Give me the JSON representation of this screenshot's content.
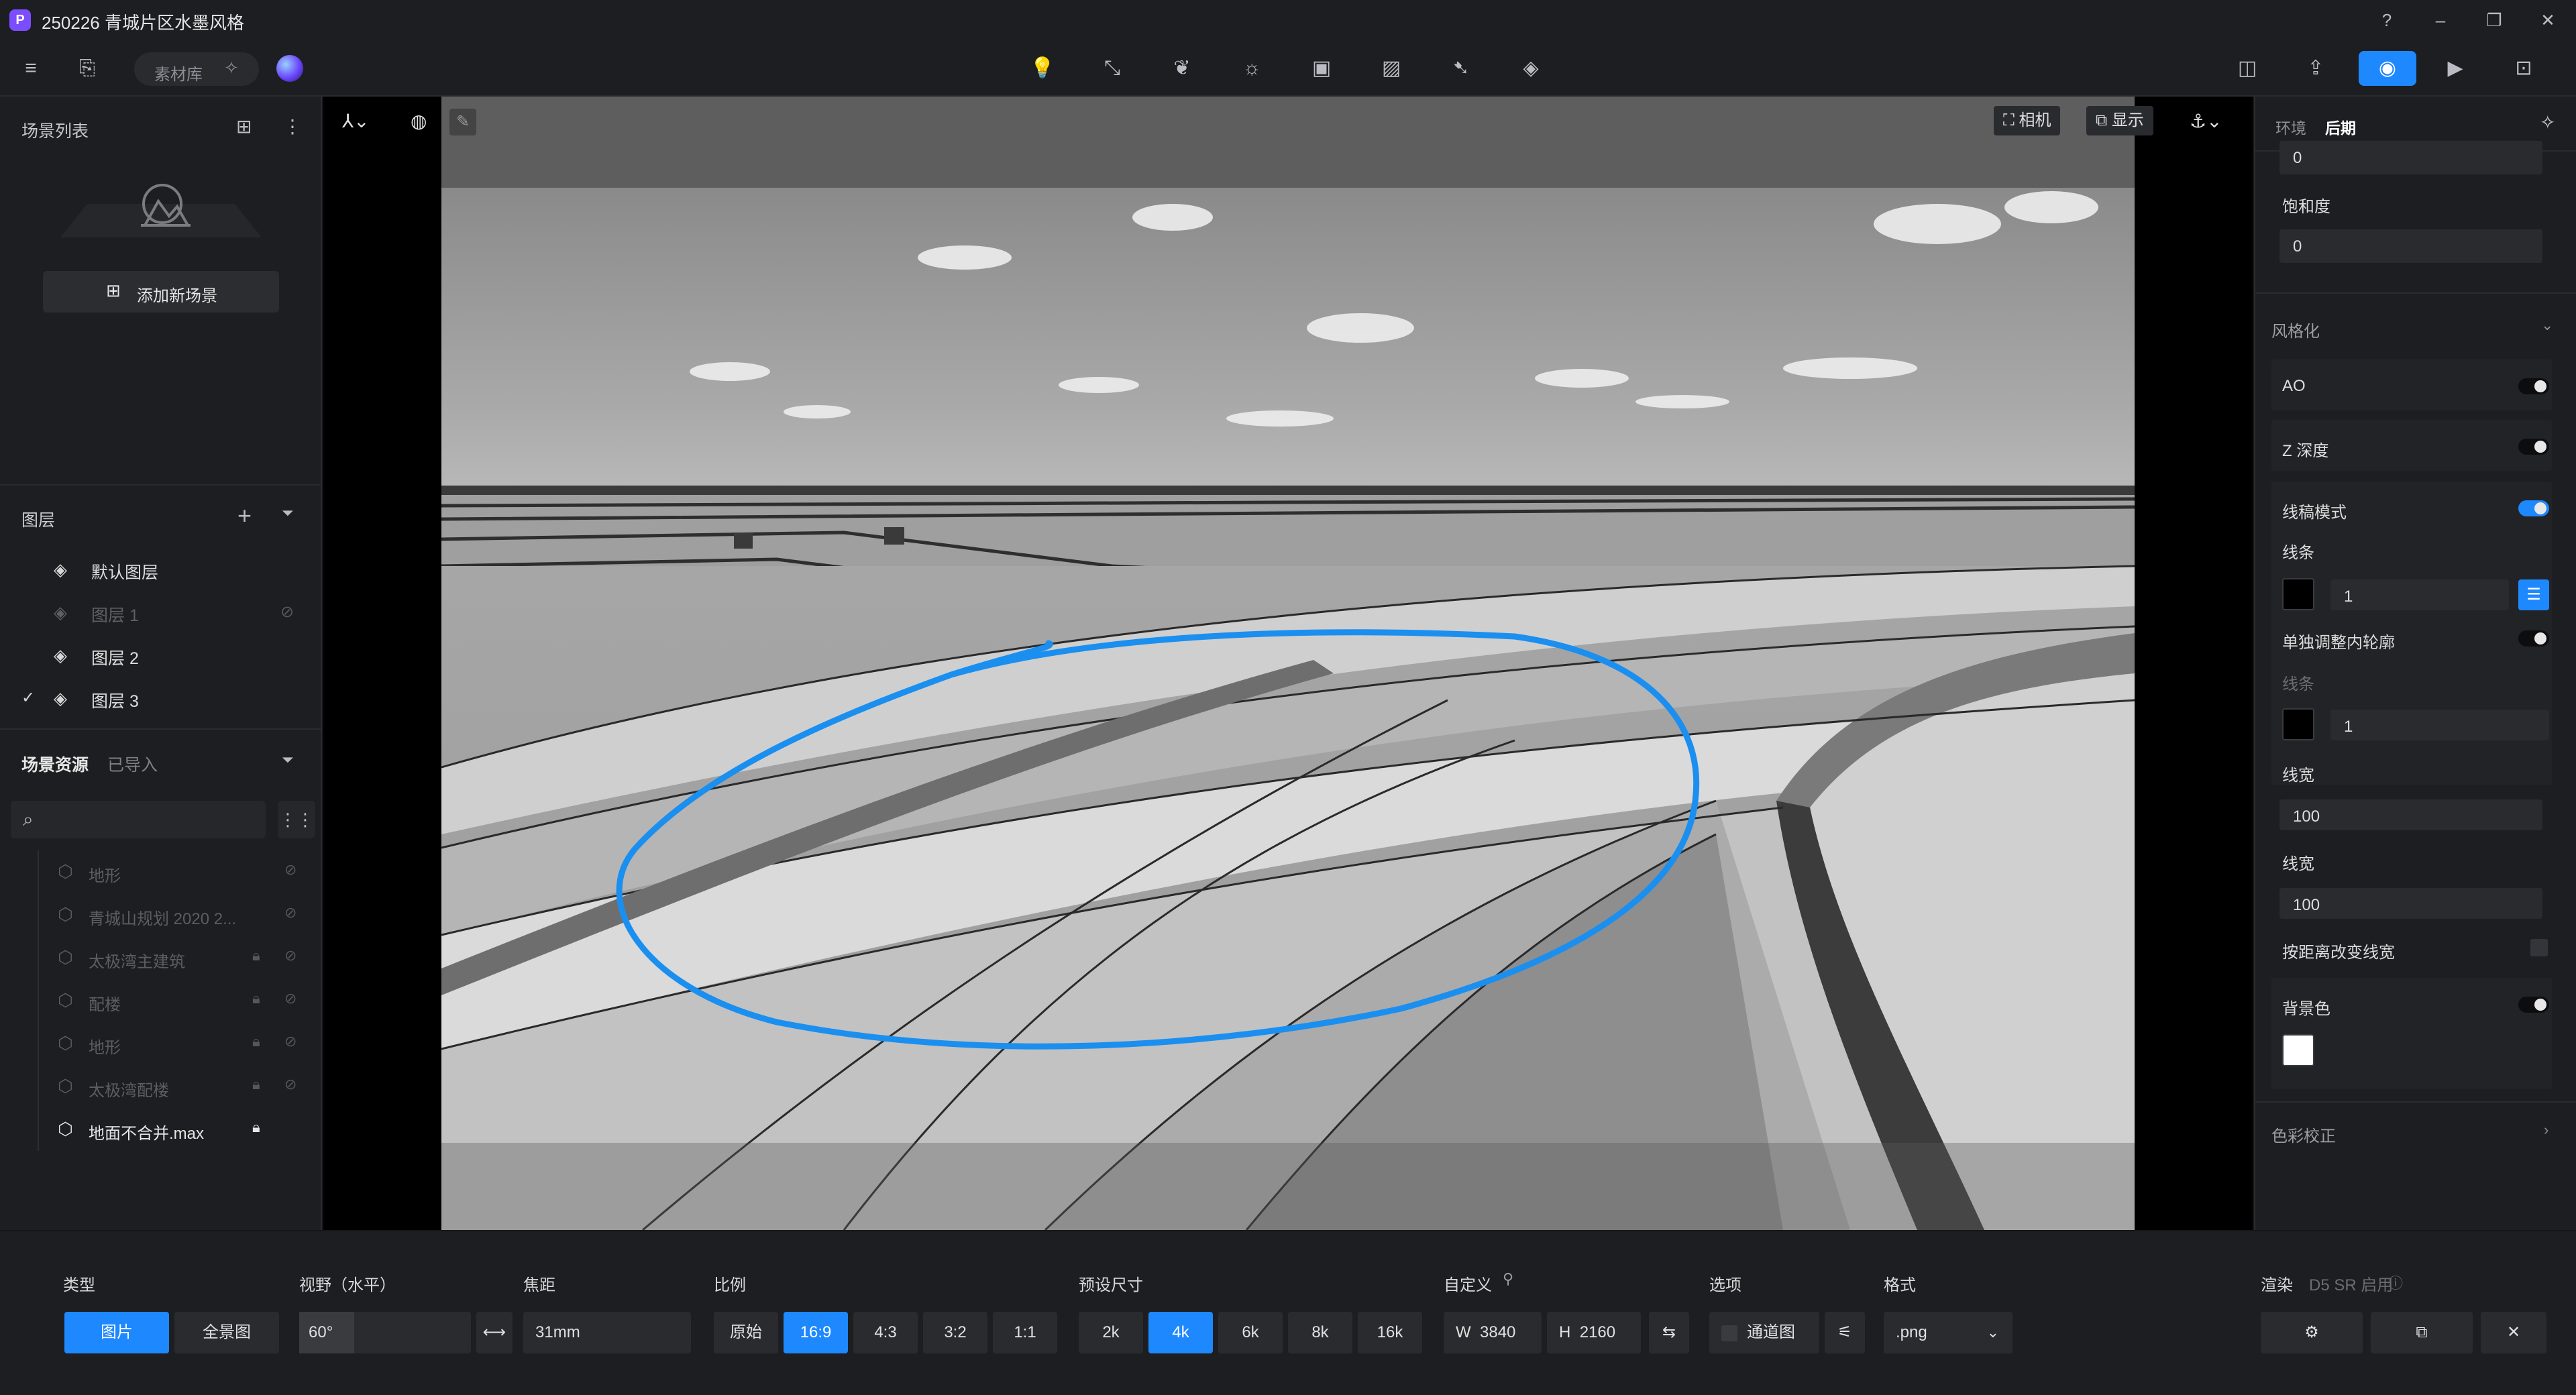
{
  "window": {
    "title": "250226 青城片区水墨风格",
    "logo": "P"
  },
  "toolbar": {
    "asset_library": "素材库",
    "left_icons": [
      "menu-icon",
      "import-icon",
      "sparkle-icon"
    ],
    "center_icons": [
      "bulb-icon",
      "path-icon",
      "leaf-icon",
      "flame-icon",
      "video-clip-icon",
      "texture-icon",
      "pointer-icon",
      "layers-icon"
    ],
    "right_icons": [
      "gallery-icon",
      "export-icon",
      "camera-icon",
      "video-icon",
      "inbox-icon"
    ],
    "active_color": "#1e88ff"
  },
  "scene_list": {
    "title": "场景列表",
    "add_scene": "添加新场景"
  },
  "layers": {
    "title": "图层",
    "items": [
      {
        "label": "默认图层",
        "dim": false,
        "checked": false
      },
      {
        "label": "图层 1",
        "dim": true,
        "checked": false
      },
      {
        "label": "图层 2",
        "dim": false,
        "checked": false
      },
      {
        "label": "图层 3",
        "dim": false,
        "checked": true
      }
    ]
  },
  "assets": {
    "tab_scene": "场景资源",
    "tab_imported": "已导入",
    "search_placeholder": "",
    "items": [
      {
        "label": "地形",
        "locked": false,
        "active": false
      },
      {
        "label": "青城山规划 2020 2...",
        "locked": false,
        "active": false
      },
      {
        "label": "太极湾主建筑",
        "locked": true,
        "active": false
      },
      {
        "label": "配楼",
        "locked": true,
        "active": false
      },
      {
        "label": "地形",
        "locked": true,
        "active": false
      },
      {
        "label": "太极湾配楼",
        "locked": true,
        "active": false
      },
      {
        "label": "地面不合并.max",
        "locked": true,
        "active": true
      }
    ]
  },
  "viewport": {
    "camera_btn": "相机",
    "display_btn": "显示"
  },
  "right_panel": {
    "tab_env": "环境",
    "tab_post": "后期",
    "value_top": "0",
    "saturation_label": "饱和度",
    "saturation_value": "0",
    "stylize_title": "风格化",
    "ao_label": "AO",
    "z_depth_label": "Z 深度",
    "line_mode_label": "线稿模式",
    "line_label": "线条",
    "line_value": "1",
    "separate_label": "单独调整内轮廓",
    "line_label_2": "线条",
    "line_value_2": "1",
    "width_label": "线宽",
    "width_value": "100",
    "width_label_2": "线宽",
    "width_value_2": "100",
    "distance_label": "按距离改变线宽",
    "bg_color_label": "背景色",
    "color_correct_title": "色彩校正",
    "line_color": "#000000",
    "bg_color": "#ffffff"
  },
  "bottom_bar": {
    "type_label": "类型",
    "type_image": "图片",
    "type_pano": "全景图",
    "fov_label": "视野（水平）",
    "fov_value": "60°",
    "focal_label": "焦距",
    "focal_value": "31mm",
    "ratio_label": "比例",
    "ratios": [
      "原始",
      "16:9",
      "4:3",
      "3:2",
      "1:1"
    ],
    "active_ratio": "16:9",
    "preset_label": "预设尺寸",
    "presets": [
      "2k",
      "4k",
      "6k",
      "8k",
      "16k"
    ],
    "active_preset": "4k",
    "custom_label": "自定义",
    "width_prefix": "W",
    "width_value": "3840",
    "height_prefix": "H",
    "height_value": "2160",
    "options_label": "选项",
    "channel_label": "通道图",
    "format_label": "格式",
    "format_value": ".png",
    "render_label": "渲染",
    "render_sub": "D5 SR 启用"
  }
}
